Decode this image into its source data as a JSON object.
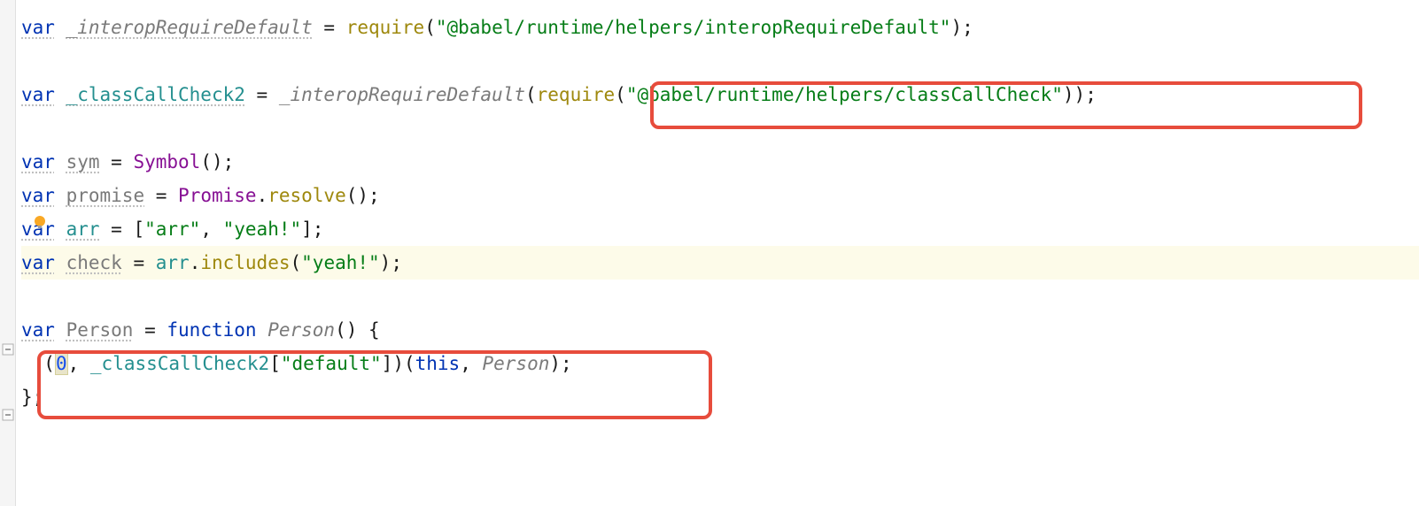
{
  "colors": {
    "keyword": "#0033b3",
    "identifier": "#248f8f",
    "string": "#067d17",
    "number": "#1750eb",
    "function": "#9e880d",
    "purple": "#871094",
    "gray": "#7a7a7a",
    "highlight_bg": "#fdfbe9",
    "red_border": "#e74c3c"
  },
  "code": {
    "l1": {
      "var": "var",
      "name": "_interopRequireDefault",
      "eq": " = ",
      "require": "require",
      "open": "(",
      "arg": "\"@babel/runtime/helpers/interopRequireDefault\"",
      "close": ");"
    },
    "l2": {
      "var": "var",
      "name": "_classCallCheck2",
      "eq": " = ",
      "fn": "_interopRequireDefault",
      "open": "(",
      "require": "require",
      "open2": "(",
      "arg": "\"@babel/runtime/helpers/classCallCheck\"",
      "close": "));"
    },
    "l3": {
      "var": "var",
      "name": "sym",
      "eq": " = ",
      "ctor": "Symbol",
      "tail": "();"
    },
    "l4": {
      "var": "var",
      "name": "promise",
      "eq": " = ",
      "ctor": "Promise",
      "dot": ".",
      "method": "resolve",
      "tail": "();"
    },
    "l5": {
      "var": "var",
      "name": "arr",
      "eq": " = [",
      "s1": "\"arr\"",
      "comma": ", ",
      "s2": "\"yeah!\"",
      "tail": "];"
    },
    "l6": {
      "var": "var",
      "name": "check",
      "eq": " = ",
      "ref": "arr",
      "dot": ".",
      "method": "includes",
      "open": "(",
      "arg": "\"yeah!\"",
      "close": ");"
    },
    "l7": {
      "var": "var",
      "name": "Person",
      "eq": " = ",
      "fnkw": "function",
      "space": " ",
      "fnname": "Person",
      "tail": "() {"
    },
    "l8": {
      "indent": "  ",
      "open": "(",
      "num": "0",
      "comma": ", ",
      "ref": "_classCallCheck2",
      "bracket_open": "[",
      "key": "\"default\"",
      "bracket_close": "]",
      "close1": ")",
      "open2": "(",
      "this": "this",
      "comma2": ", ",
      "arg": "Person",
      "close2": ");"
    },
    "l9": {
      "text": "};"
    }
  },
  "icons": {
    "bulb": "lightbulb-icon",
    "fold_expand": "fold-minus-icon"
  }
}
